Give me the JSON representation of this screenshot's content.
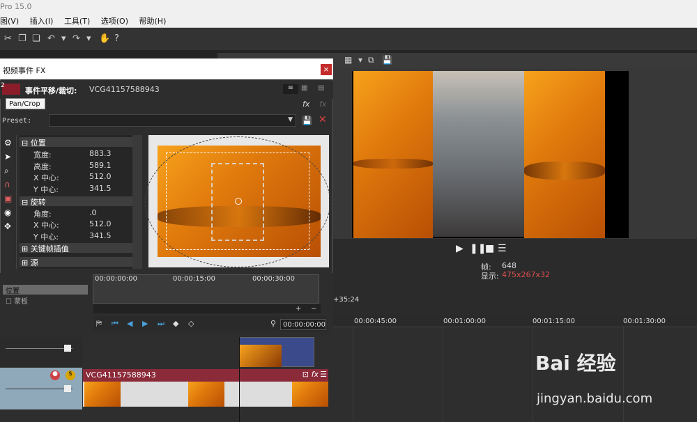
{
  "app": {
    "title": "Pro 15.0"
  },
  "menu": [
    "图(V)",
    "插入(I)",
    "工具(T)",
    "选项(O)",
    "帮助(H)"
  ],
  "fx_dialog": {
    "title": "视频事件 FX",
    "close": "×",
    "chain_number": "2",
    "chain_name": "事件平移/裁切:",
    "clip_name": "VCG41157588943",
    "tooltip": "Pan/Crop",
    "preset_label": "Preset:",
    "groups": {
      "position": "位置",
      "rotation": "旋转",
      "keyframe_interp": "关键帧插值",
      "source": "源"
    },
    "position_props": [
      {
        "label": "宽度:",
        "value": "883.3"
      },
      {
        "label": "高度:",
        "value": "589.1"
      },
      {
        "label": "X 中心:",
        "value": "512.0"
      },
      {
        "label": "Y 中心:",
        "value": "341.5"
      }
    ],
    "rotation_props": [
      {
        "label": "角度:",
        "value": ".0"
      },
      {
        "label": "X 中心:",
        "value": "512.0"
      },
      {
        "label": "Y 中心:",
        "value": "341.5"
      }
    ],
    "keyframe_track_label": "位置",
    "mask_label": "蒙板",
    "keyframe_times": [
      "00:00:00:00",
      "00:00:15:00",
      "00:00:30:00"
    ],
    "current_time": "00:00:00:00"
  },
  "preview": {
    "frame_label": "帧:",
    "frame_value": "648",
    "display_label": "显示:",
    "display_value": "475x267x32"
  },
  "timeline": {
    "time_partial": "+35:24",
    "ruler": [
      "00:00:45:00",
      "00:01:00:00",
      "00:01:15:00",
      "00:01:30:00"
    ],
    "clip_name": "VCG41157588943"
  },
  "watermark": {
    "brand": "Bai  经验",
    "url": "jingyan.baidu.com"
  },
  "colors": {
    "accent_red": "#c42b2b",
    "clip_header": "#8b2b3a",
    "display_value": "#e05050"
  }
}
